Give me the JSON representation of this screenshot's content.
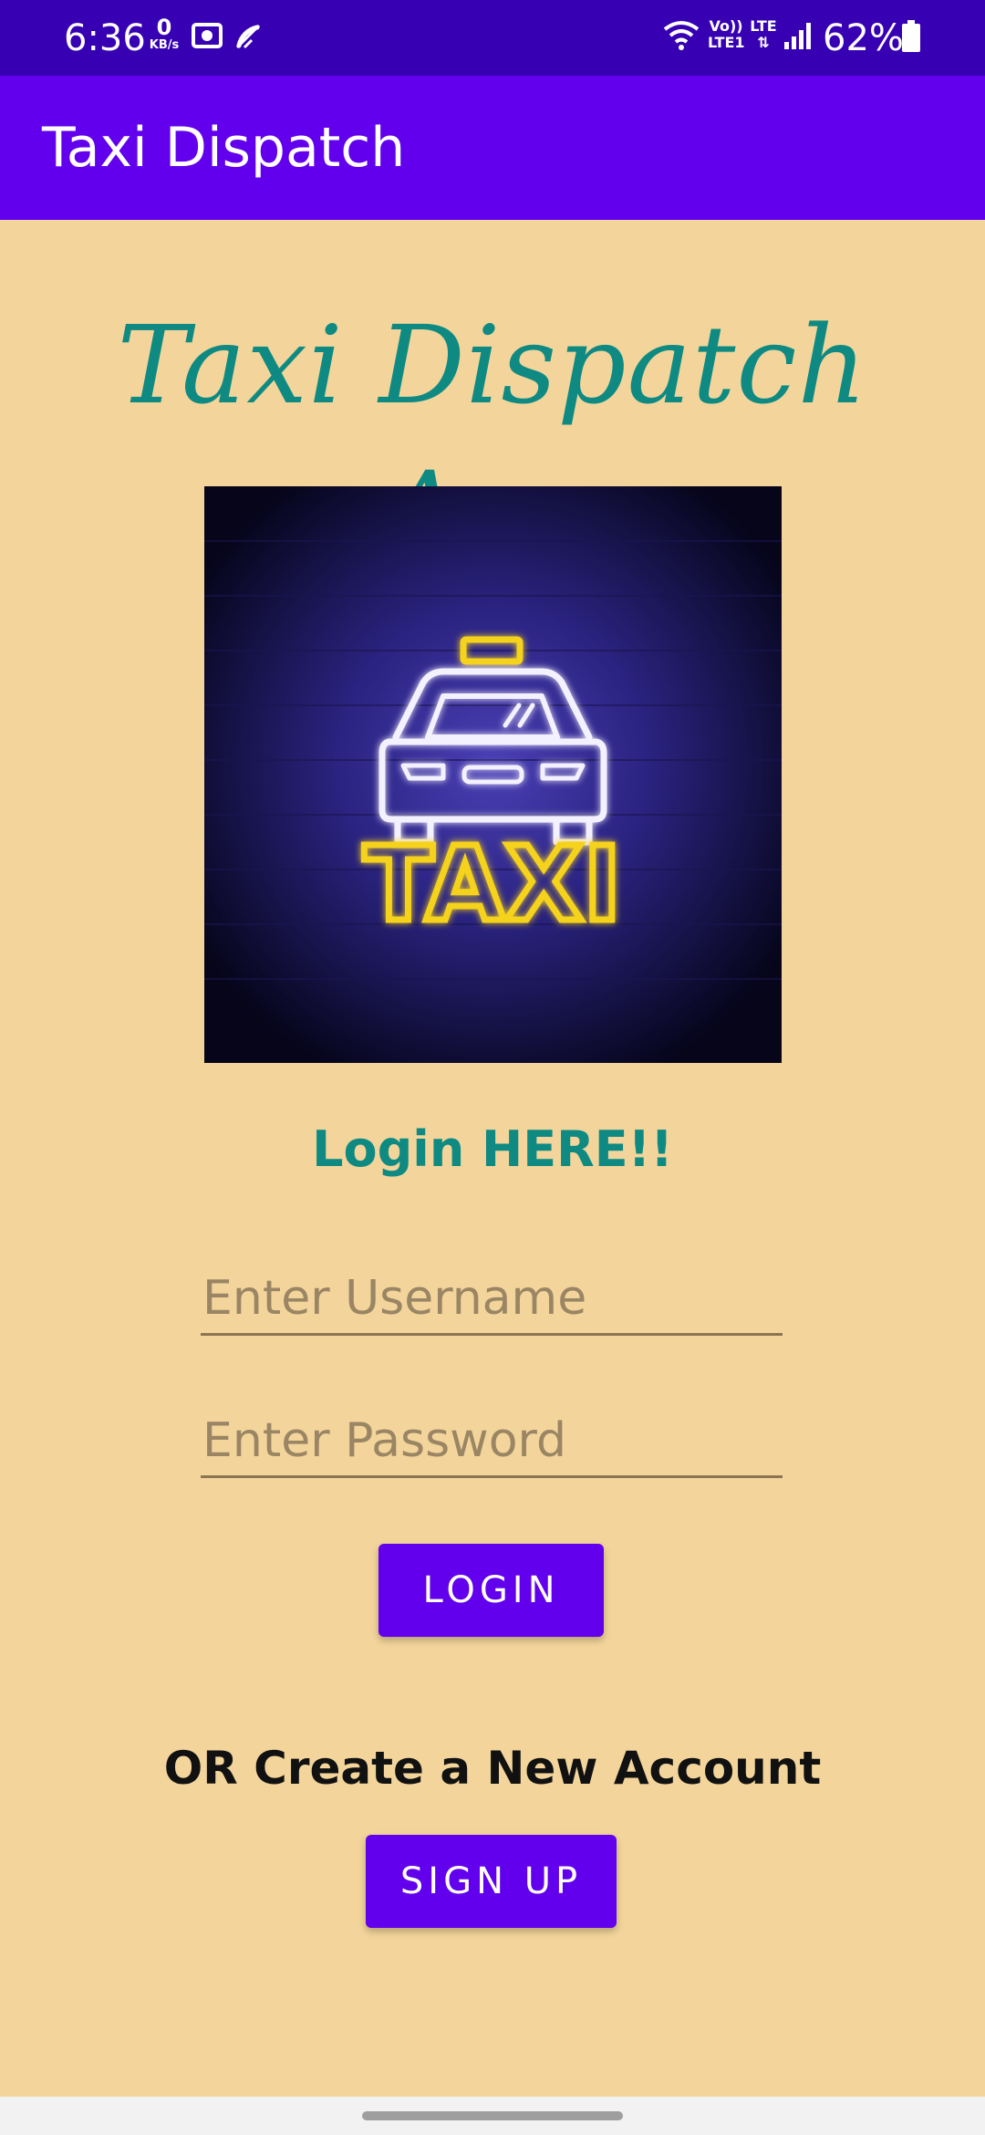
{
  "status_bar": {
    "time": "6:36",
    "data_rate_value": "0",
    "data_rate_unit": "KB/s",
    "network_label_top": "Vo))",
    "network_label_bottom": "LTE1",
    "lte_label": "LTE",
    "battery_percent": "62%",
    "icons": [
      "camera-icon",
      "phone-muted-icon",
      "wifi-icon",
      "signal-icon",
      "battery-icon"
    ]
  },
  "app_bar": {
    "title": "Taxi Dispatch"
  },
  "main": {
    "heading": "Taxi Dispatch App",
    "logo_text": "TAXI",
    "login_heading": "Login HERE!!",
    "username_placeholder": "Enter Username",
    "password_placeholder": "Enter Password",
    "login_button": "LOGIN",
    "create_account_text": "OR Create a New Account",
    "signup_button": "SIGN UP"
  },
  "colors": {
    "background": "#f3d59b",
    "status_bar": "#3700b3",
    "app_bar": "#6200ee",
    "accent_text": "#0f8a82",
    "button": "#6200ee"
  }
}
